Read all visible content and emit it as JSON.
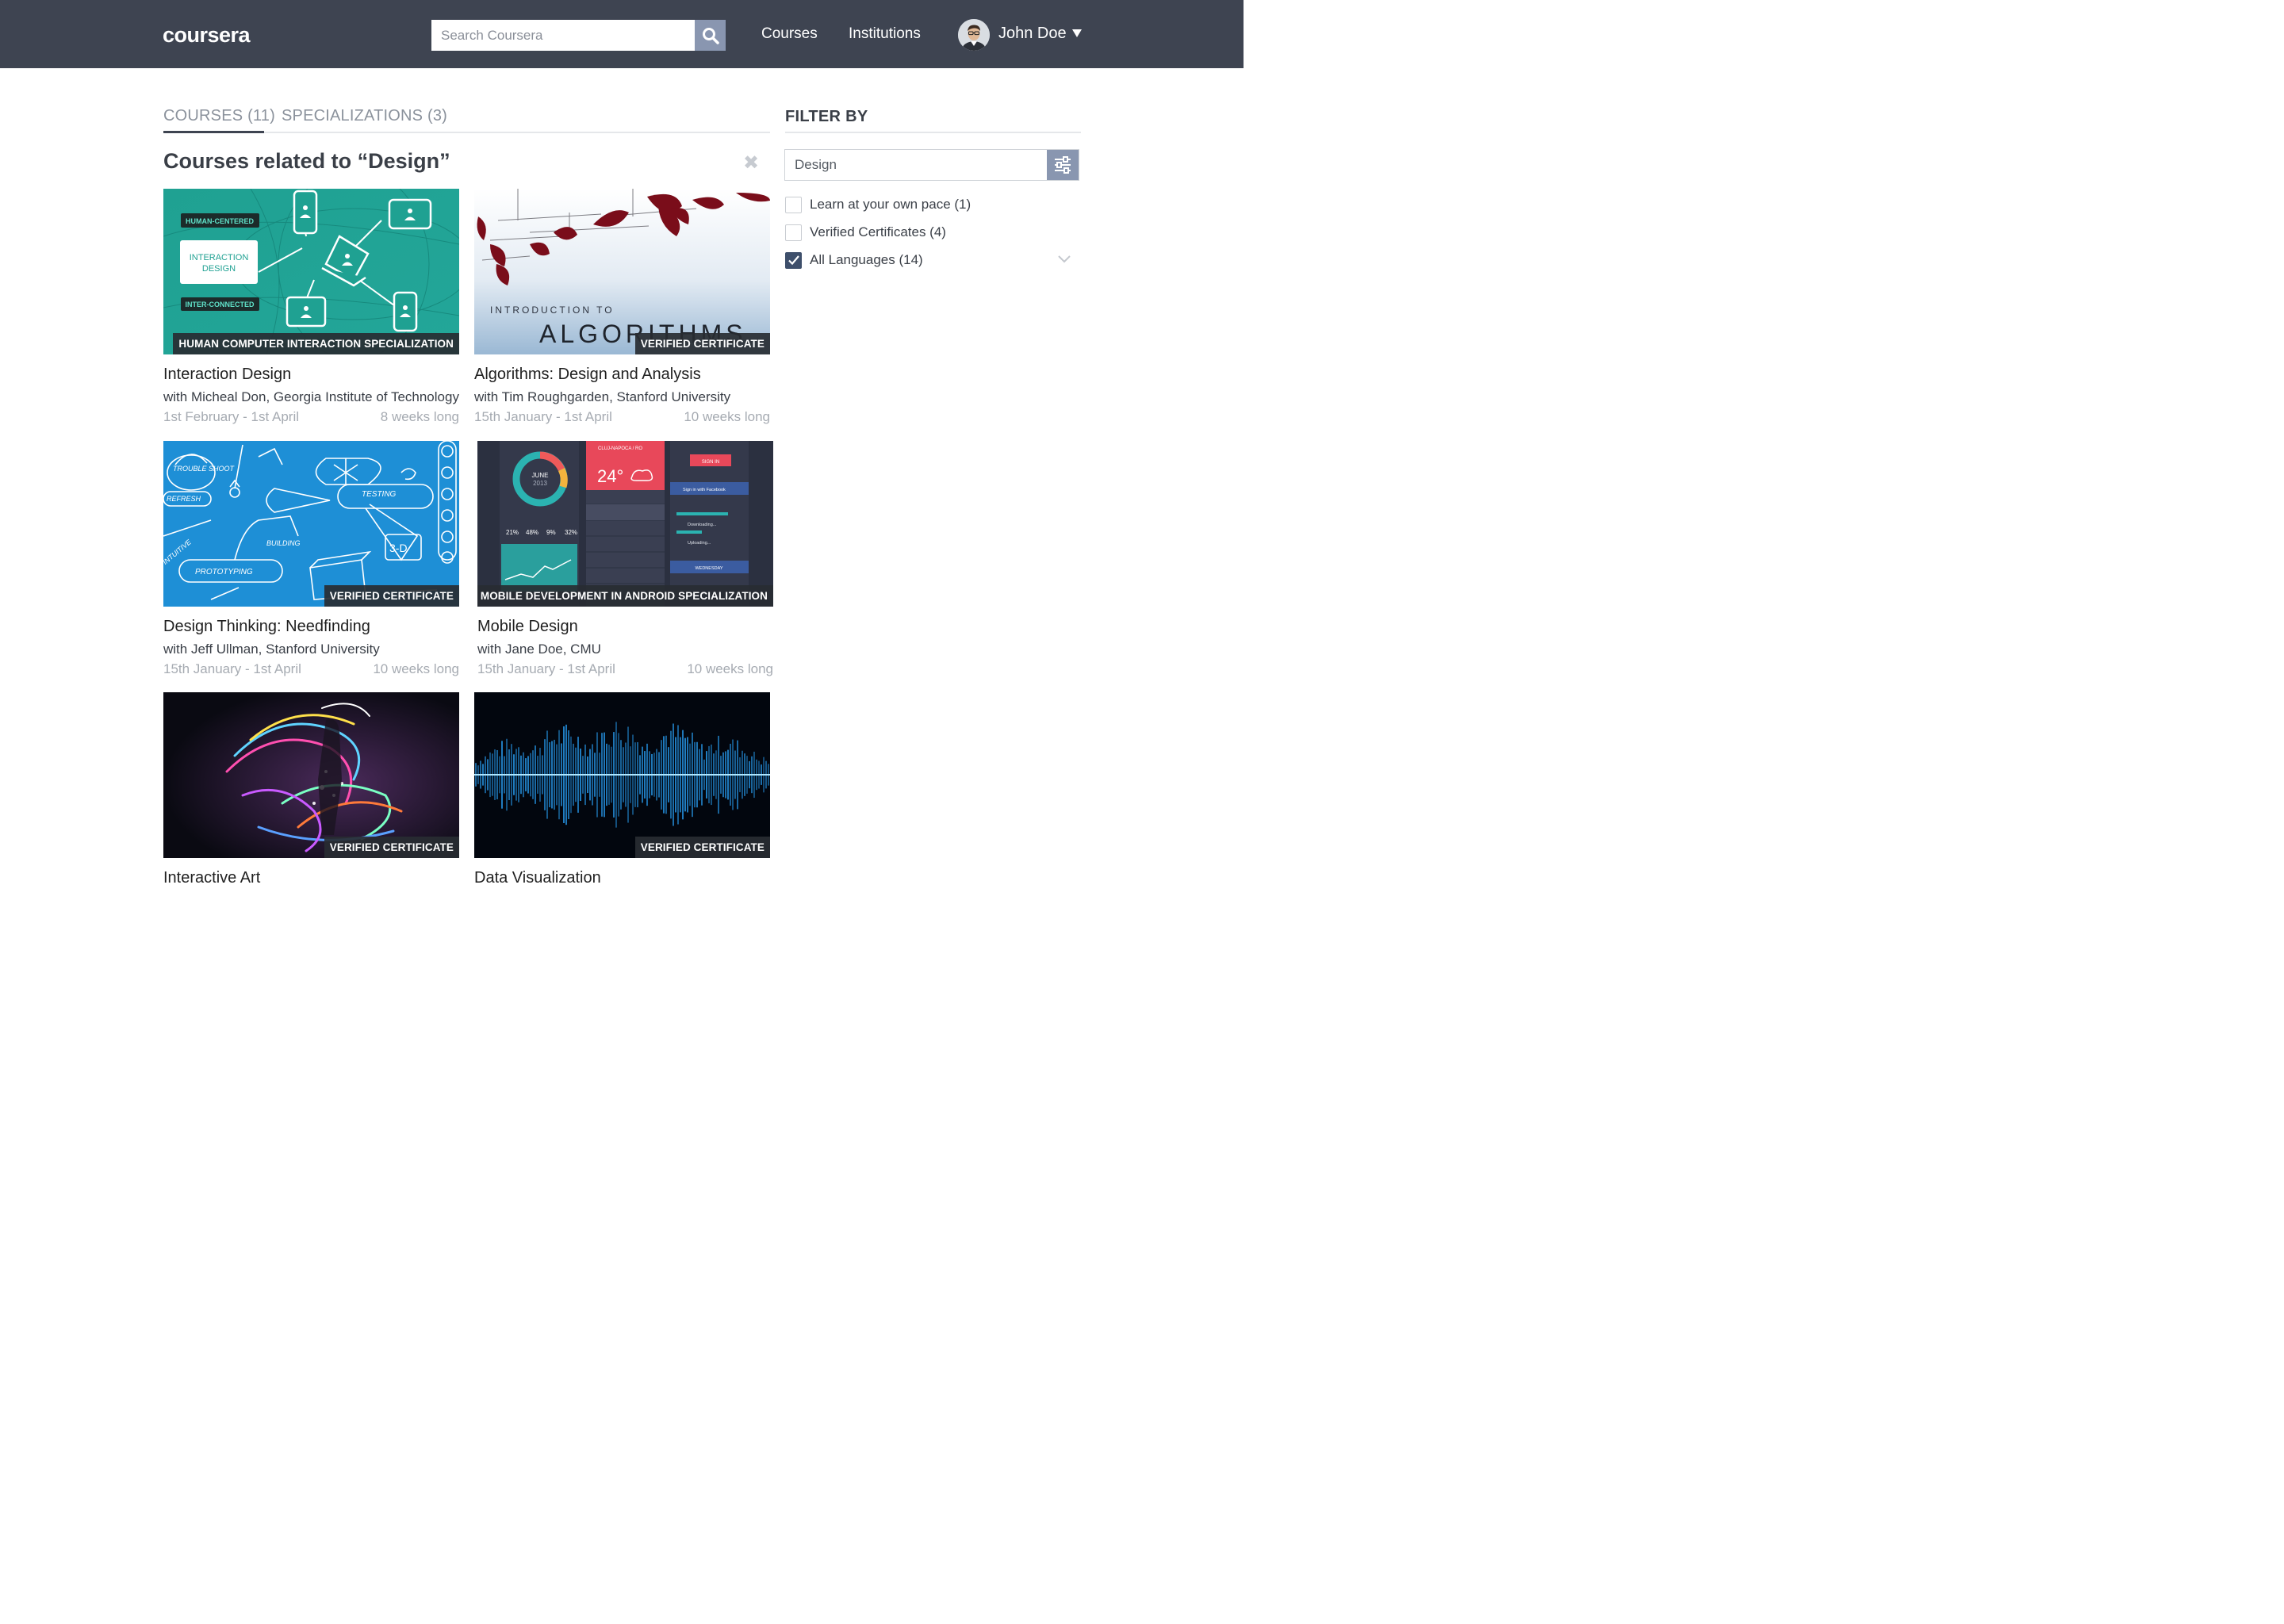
{
  "header": {
    "logo": "coursera",
    "search_placeholder": "Search Coursera",
    "nav": [
      "Courses",
      "Institutions"
    ],
    "user_name": "John Doe"
  },
  "tabs": [
    {
      "label": "COURSES (11)",
      "active": true
    },
    {
      "label": "SPECIALIZATIONS (3)",
      "active": false
    }
  ],
  "section_title": "Courses related to “Design”",
  "courses": [
    {
      "title": "Interaction Design",
      "instructor": "with Micheal Don, Georgia Institute of Technology",
      "dates": "1st February - 1st April",
      "length": "8 weeks long",
      "badge": "HUMAN COMPUTER INTERACTION SPECIALIZATION",
      "thumb_labels": [
        "HUMAN-CENTERED",
        "INTERACTION",
        "DESIGN",
        "INTER-CONNECTED"
      ]
    },
    {
      "title": "Algorithms: Design and Analysis",
      "instructor": "with Tim Roughgarden, Stanford University",
      "dates": "15th January - 1st April",
      "length": "10 weeks long",
      "badge": "VERIFIED CERTIFICATE",
      "thumb_labels": [
        "INTRODUCTION TO",
        "ALGORITHMS"
      ]
    },
    {
      "title": "Design Thinking: Needfinding",
      "instructor": "with Jeff Ullman, Stanford University",
      "dates": "15th January - 1st April",
      "length": "10 weeks long",
      "badge": "VERIFIED CERTIFICATE",
      "thumb_labels": [
        "TROUBLE SHOOT",
        "TESTING",
        "REFRESH",
        "INTUITIVE",
        "BUILDING",
        "PROTOTYPING",
        "3-D"
      ]
    },
    {
      "title": "Mobile Design",
      "instructor": "with Jane Doe, CMU",
      "dates": "15th January - 1st April",
      "length": "10 weeks long",
      "badge": "MOBILE DEVELOPMENT IN ANDROID SPECIALIZATION",
      "thumb_labels": [
        "JUNE",
        "2013",
        "CLUJ-NAPOCA / RO",
        "24°",
        "SIGN IN",
        "Sign in with Facebook",
        "WEDNESDAY",
        "Downloading...",
        "Uploading..."
      ]
    },
    {
      "title": "Interactive Art",
      "badge": "VERIFIED CERTIFICATE"
    },
    {
      "title": "Data Visualization",
      "badge": "VERIFIED CERTIFICATE"
    }
  ],
  "filter": {
    "title": "FILTER BY",
    "value": "Design",
    "options": [
      {
        "label": "Learn at your own pace (1)",
        "checked": false
      },
      {
        "label": "Verified Certificates (4)",
        "checked": false
      },
      {
        "label": "All Languages (14)",
        "checked": true
      }
    ]
  },
  "colors": {
    "header_bg": "#3e4451",
    "accent_button": "#8996b0",
    "checkbox_checked": "#3e4f6b"
  },
  "icons": [
    "search-icon",
    "close-icon",
    "sliders-icon",
    "check-icon",
    "chevron-down-icon",
    "caret-down-icon"
  ]
}
